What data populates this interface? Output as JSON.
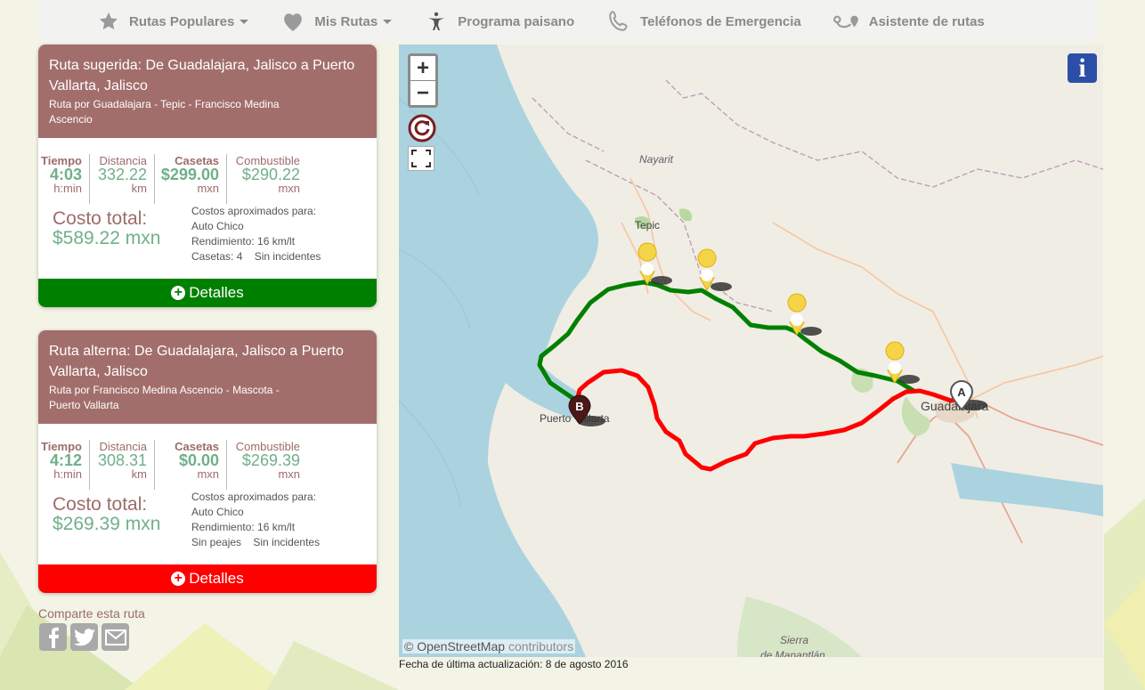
{
  "nav": {
    "items": [
      {
        "label": "Rutas Populares",
        "icon": "star-icon",
        "dropdown": true
      },
      {
        "label": "Mis Rutas",
        "icon": "heart-icon",
        "dropdown": true
      },
      {
        "label": "Programa paisano",
        "icon": "person-icon",
        "dropdown": false
      },
      {
        "label": "Teléfonos de Emergencia",
        "icon": "phone-icon",
        "dropdown": false
      },
      {
        "label": "Asistente de rutas",
        "icon": "route-assistant-icon",
        "dropdown": false
      }
    ]
  },
  "routes": [
    {
      "title": "Ruta sugerida: De Guadalajara, Jalisco a Puerto Vallarta, Jalisco",
      "subtitle": "Ruta por Guadalajara - Tepic - Francisco Medina Ascencio",
      "stats": {
        "tiempo_label": "Tiempo",
        "tiempo_value": "4:03",
        "tiempo_unit": "h:min",
        "distancia_label": "Distancia",
        "distancia_value": "332.22",
        "distancia_unit": "km",
        "casetas_label": "Casetas",
        "casetas_value": "$299.00",
        "casetas_unit": "mxn",
        "combustible_label": "Combustible",
        "combustible_value": "$290.22",
        "combustible_unit": "mxn"
      },
      "cost_label": "Costo total:",
      "cost_value": "$589.22 mxn",
      "notes": {
        "line1": "Costos aproximados para:",
        "line2": "Auto Chico",
        "line3": "Rendimiento: 16 km/lt",
        "line4a": "Casetas: 4",
        "line4b": "Sin incidentes"
      },
      "details_label": "Detalles",
      "color": "#008000"
    },
    {
      "title": "Ruta alterna: De Guadalajara, Jalisco a Puerto Vallarta, Jalisco",
      "subtitle": "Ruta por Francisco Medina Ascencio - Mascota - Puerto Vallarta",
      "stats": {
        "tiempo_label": "Tiempo",
        "tiempo_value": "4:12",
        "tiempo_unit": "h:min",
        "distancia_label": "Distancia",
        "distancia_value": "308.31",
        "distancia_unit": "km",
        "casetas_label": "Casetas",
        "casetas_value": "$0.00",
        "casetas_unit": "mxn",
        "combustible_label": "Combustible",
        "combustible_value": "$269.39",
        "combustible_unit": "mxn"
      },
      "cost_label": "Costo total:",
      "cost_value": "$269.39 mxn",
      "notes": {
        "line1": "Costos aproximados para:",
        "line2": "Auto Chico",
        "line3": "Rendimiento: 16 km/lt",
        "line4a": "Sin peajes",
        "line4b": "Sin incidentes"
      },
      "details_label": "Detalles",
      "color": "#ff0000"
    }
  ],
  "share": {
    "label": "Comparte esta ruta",
    "icons": [
      "facebook-icon",
      "twitter-icon",
      "email-icon"
    ]
  },
  "map": {
    "zoom_in": "+",
    "zoom_out": "−",
    "info": "i",
    "labels": {
      "region": "Nayarit",
      "tepic": "Tepic",
      "puerto_vallarta": "Puerto Vallarta",
      "guadalajara": "Guadalajara",
      "sierra": "Sierra",
      "manantlan": "de Manantlán"
    },
    "marker_a": "A",
    "marker_b": "B",
    "attribution_prefix": "© OpenStreetMap",
    "attribution_link": "contributors"
  },
  "footer": {
    "updated": "Fecha de última actualización: 8 de agosto 2016"
  },
  "colors": {
    "card_header": "#a26e6b",
    "accent_green_text": "#70b088",
    "route_green": "#008000",
    "route_red": "#ff0000"
  }
}
